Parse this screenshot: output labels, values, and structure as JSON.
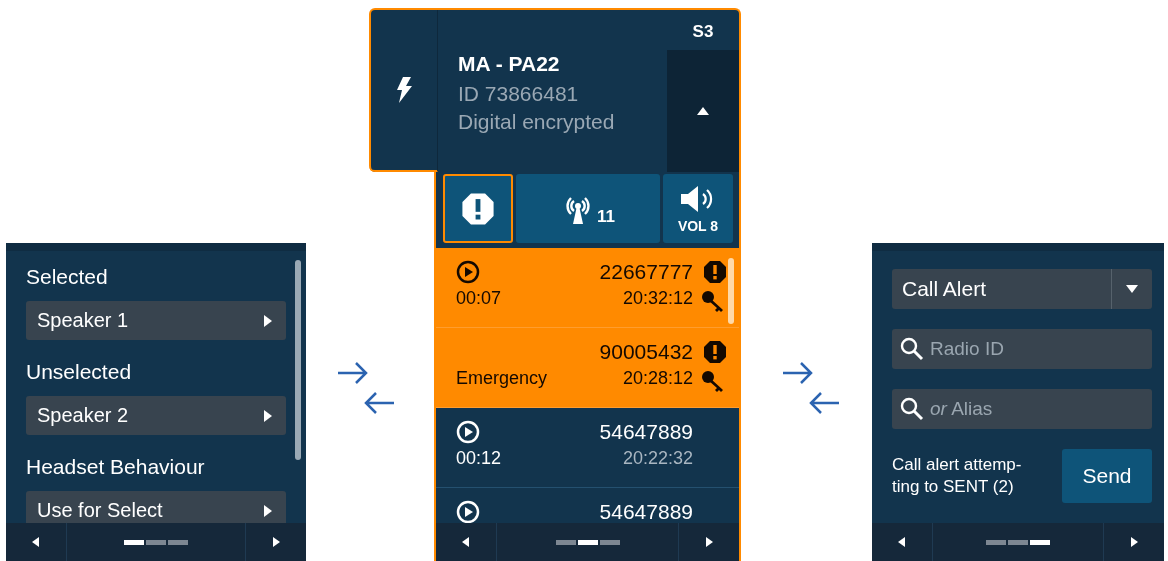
{
  "settings_panel": {
    "settings": [
      {
        "label": "Selected",
        "value": "Speaker 1"
      },
      {
        "label": "Unselected",
        "value": "Speaker 2"
      },
      {
        "label": "Headset Behaviour",
        "value": "Use for Select"
      }
    ],
    "pager": [
      {
        "selected": true
      },
      {
        "selected": false
      },
      {
        "selected": false
      }
    ]
  },
  "channel_panel": {
    "name": "MA - PA22",
    "id": "ID 73866481",
    "mode": "Digital encrypted",
    "slot": "S3",
    "emergency_button": {
      "selected": true
    },
    "signal_count": "11",
    "volume": "VOL 8",
    "calls": [
      {
        "number": "22667777",
        "note": "00:07",
        "time": "20:32:12",
        "emergency": true,
        "encrypted": true,
        "recording": true
      },
      {
        "number": "90005432",
        "note": "Emergency",
        "time": "20:28:12",
        "emergency": true,
        "encrypted": true,
        "recording": false
      },
      {
        "number": "54647889",
        "note": "00:12",
        "time": "20:22:32",
        "emergency": false,
        "encrypted": false,
        "recording": true
      },
      {
        "number": "54647889",
        "emergency": false,
        "encrypted": false,
        "recording": true
      }
    ],
    "pager": [
      {
        "selected": false
      },
      {
        "selected": true
      },
      {
        "selected": false
      }
    ]
  },
  "alert_panel": {
    "alert_type": "Call Alert",
    "radio_id": {
      "placeholder": "Radio ID"
    },
    "alias": {
      "placeholder": "*or* Alias"
    },
    "status": "Call alert attemp-\nting to SENT (2)",
    "send_button": "Send",
    "pager": [
      {
        "selected": false
      },
      {
        "selected": false
      },
      {
        "selected": true
      }
    ]
  }
}
